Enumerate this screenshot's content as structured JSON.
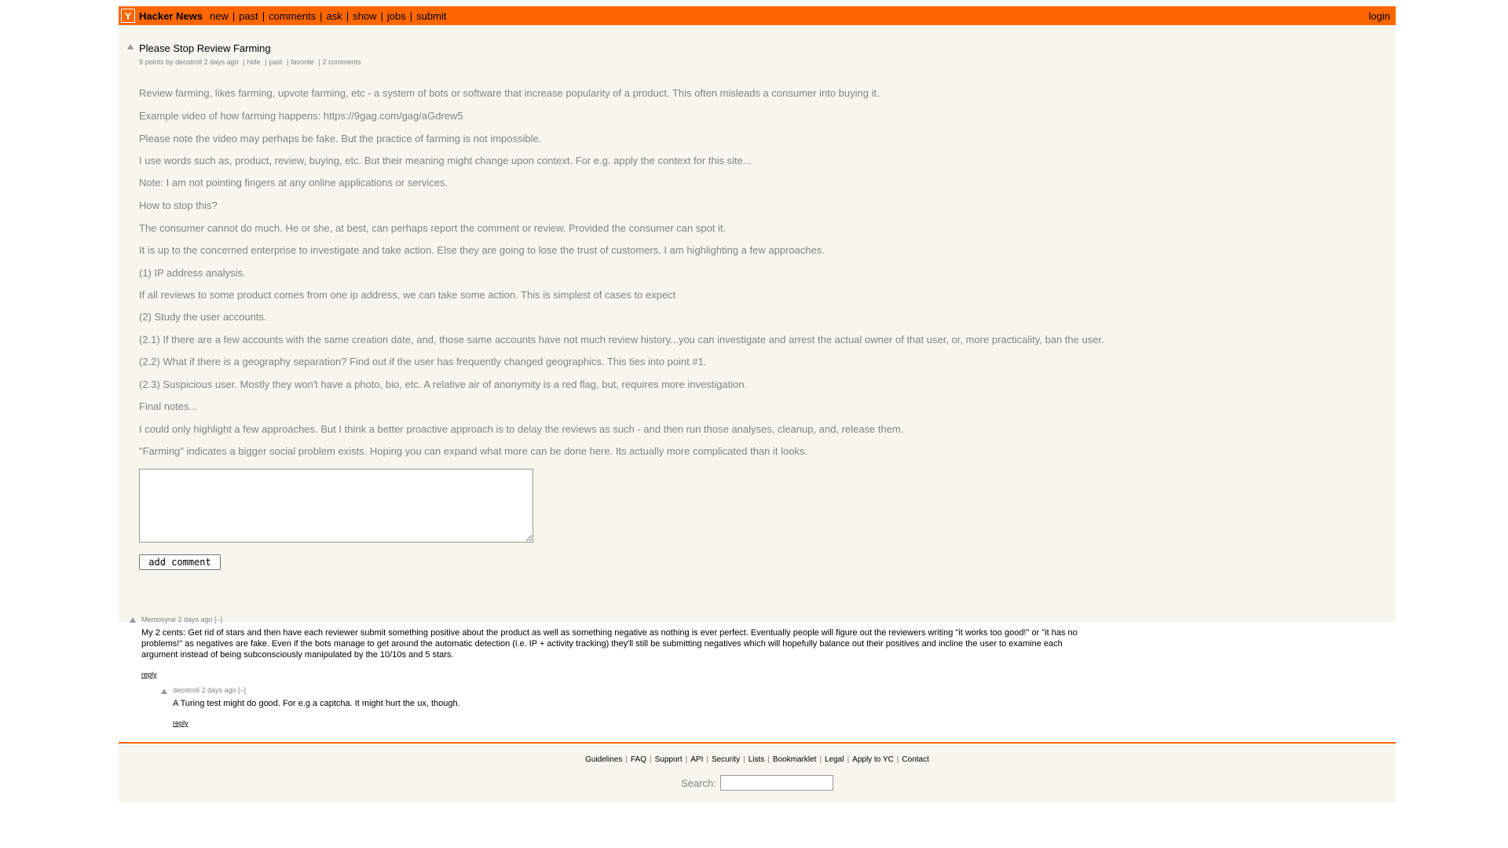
{
  "header": {
    "logo_letter": "Y",
    "site_name": "Hacker News",
    "nav": [
      "new",
      "past",
      "comments",
      "ask",
      "show",
      "jobs",
      "submit"
    ],
    "nav_separator": "|",
    "login": "login"
  },
  "story": {
    "title": "Please Stop Review Farming",
    "subtext": {
      "score": "9 points",
      "by_prefix": "by",
      "user": "deostroll",
      "age": "2 days ago",
      "hide": "hide",
      "past": "past",
      "favorite": "favorite",
      "comments": "2 comments"
    },
    "paragraphs": [
      "Review farming, likes farming, upvote farming, etc - a system of bots or software that increase popularity of a product. This often misleads a consumer into buying it.",
      "Example video of how farming happens: https://9gag.com/gag/aGdrew5",
      "Please note the video may perhaps be fake. But the practice of farming is not impossible.",
      "I use words such as, product, review, buying, etc. But their meaning might change upon context. For e.g. apply the context for this site...",
      "Note: I am not pointing fingers at any online applications or services.",
      "How to stop this?",
      "The consumer cannot do much. He or she, at best, can perhaps report the comment or review. Provided the consumer can spot it.",
      "It is up to the concerned enterprise to investigate and take action. Else they are going to lose the trust of customers. I am highlighting a few approaches.",
      "(1) IP address analysis.",
      "If all reviews to some product comes from one ip address, we can take some action. This is simplest of cases to expect",
      "(2) Study the user accounts.",
      "(2.1) If there are a few accounts with the same creation date, and, those same accounts have not much review history...you can investigate and arrest the actual owner of that user, or, more practicality, ban the user.",
      "(2.2) What if there is a geography separation? Find out if the user has frequently changed geographics. This ties into point #1.",
      "(2.3) Suspicious user. Mostly they won't have a photo, bio, etc. A relative air of anonymity is a red flag, but, requires more investigation.",
      "Final notes...",
      "I could only highlight a few approaches. But I think a better proactive approach is to delay the reviews as such - and then run those analyses, cleanup, and, release them.",
      "\"Farming\" indicates a bigger social problem exists. Hoping you can expand what more can be done here. Its actually more complicated than it looks."
    ],
    "comment_box_value": "",
    "add_comment_label": "add comment"
  },
  "comments": [
    {
      "user": "Memosyne",
      "age": "2 days ago",
      "toggle": "[–]",
      "text": "My 2 cents: Get rid of stars and then have each reviewer submit something positive about the product as well as something negative as nothing is ever perfect. Eventually people will figure out the reviewers writing \"it works too good!\" or \"it has no problems!\" as negatives are fake. Even if the bots manage to get around the automatic detection (i.e. IP + activity tracking) they'll still be submitting negatives which will hopefully balance out their positives and incline the user to examine each argument instead of being subconsciously manipulated by the 10/10s and 5 stars.",
      "reply": "reply"
    },
    {
      "user": "deostroll",
      "age": "2 days ago",
      "toggle": "[–]",
      "text": "A Turing test might do good. For e.g a captcha. It might hurt the ux, though.",
      "reply": "reply"
    }
  ],
  "footer": {
    "links": [
      "Guidelines",
      "FAQ",
      "Support",
      "API",
      "Security",
      "Lists",
      "Bookmarklet",
      "Legal",
      "Apply to YC",
      "Contact"
    ],
    "search_label": "Search:",
    "search_value": ""
  },
  "colors": {
    "accent": "#ff6600",
    "background": "#f6f6ef",
    "subtext": "#828282"
  }
}
